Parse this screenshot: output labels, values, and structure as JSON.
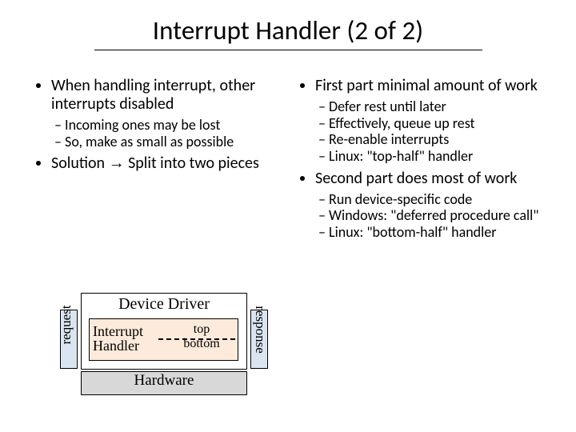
{
  "title": "Interrupt Handler (2 of 2)",
  "left": {
    "b1a": "When handling interrupt, other interrupts disabled",
    "sub1a": "Incoming ones may be lost",
    "sub1b": "So, make as small as possible",
    "b1b_pre": "Solution ",
    "b1b_arrow": "→",
    "b1b_post": " Split into two pieces"
  },
  "right": {
    "b1a": "First part minimal amount of work",
    "sub1a": "Defer rest until later",
    "sub1b": "Effectively, queue up rest",
    "sub1c": "Re-enable interrupts",
    "sub1d": "Linux: \"top-half\" handler",
    "b1b": "Second part does most of work",
    "sub2a": "Run device-specific code",
    "sub2b": "Windows: \"deferred procedure call\"",
    "sub2c": "Linux: \"bottom-half\" handler"
  },
  "diagram": {
    "driver": "Device Driver",
    "ih": "Interrupt\nHandler",
    "top": "top",
    "bottom": "bottom",
    "hardware": "Hardware",
    "request": "request",
    "response": "response"
  }
}
